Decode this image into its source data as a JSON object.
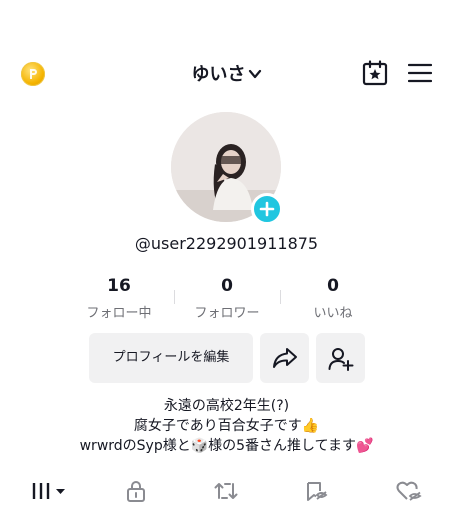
{
  "header": {
    "username": "ゆいさ",
    "icons": [
      "coin-icon",
      "chevron-down-icon",
      "calendar-star-icon",
      "menu-icon"
    ]
  },
  "profile": {
    "handle": "@user2292901911875"
  },
  "stats": [
    {
      "value": "16",
      "label": "フォロー中"
    },
    {
      "value": "0",
      "label": "フォロワー"
    },
    {
      "value": "0",
      "label": "いいね"
    }
  ],
  "actions": {
    "edit_label": "プロフィールを編集",
    "icons": [
      "share-icon",
      "add-user-icon"
    ]
  },
  "bio": {
    "line1": "永遠の高校2年生(?)",
    "line2": "腐女子であり百合女子です👍",
    "line3": "wrwrdのSyp様と🎲様の5番さん推してます💕"
  },
  "tabs": [
    "videos-grid-icon",
    "lock-icon",
    "repost-icon",
    "saved-icon",
    "liked-icon"
  ],
  "colors": {
    "accent": "#20c6e0",
    "coin": "#f5b400",
    "muted": "#6e6f75"
  }
}
